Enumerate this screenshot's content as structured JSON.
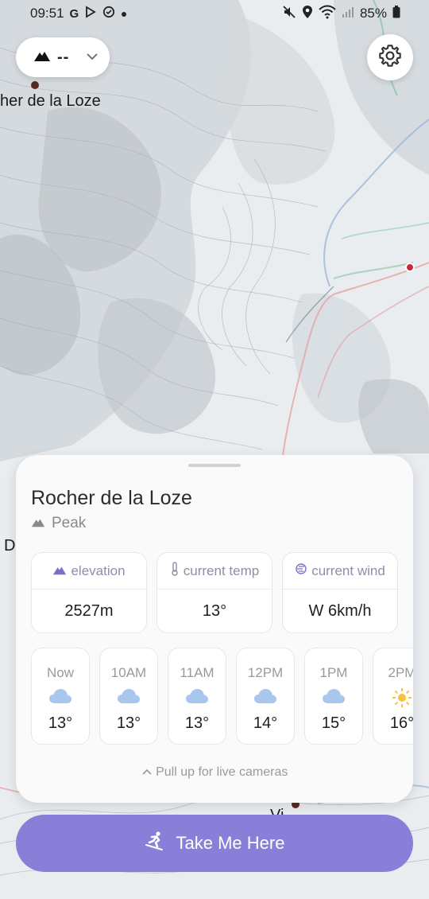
{
  "status_bar": {
    "time": "09:51",
    "left_icons": [
      "G",
      "play-store-icon",
      "shield-icon",
      "dot-icon"
    ],
    "battery": "85%"
  },
  "map": {
    "labels": [
      "her de la Loze",
      "D",
      "Vi"
    ]
  },
  "top_controls": {
    "elevation_value": "--"
  },
  "sheet": {
    "title": "Rocher de la Loze",
    "type": "Peak",
    "stats": [
      {
        "label": "elevation",
        "value": "2527m",
        "icon": "mountain-icon"
      },
      {
        "label": "current temp",
        "value": "13°",
        "icon": "thermometer-icon"
      },
      {
        "label": "current wind",
        "value": "W 6km/h",
        "icon": "wind-icon"
      }
    ],
    "hourly": [
      {
        "time": "Now",
        "temp": "13°",
        "icon": "cloud-icon"
      },
      {
        "time": "10AM",
        "temp": "13°",
        "icon": "cloud-icon"
      },
      {
        "time": "11AM",
        "temp": "13°",
        "icon": "cloud-icon"
      },
      {
        "time": "12PM",
        "temp": "14°",
        "icon": "cloud-icon"
      },
      {
        "time": "1PM",
        "temp": "15°",
        "icon": "cloud-icon"
      },
      {
        "time": "2PM",
        "temp": "16°",
        "icon": "sun-icon"
      }
    ],
    "pull_hint": "Pull up for live cameras"
  },
  "cta": {
    "label": "Take Me Here"
  },
  "colors": {
    "accent": "#8a7fd8",
    "pin_red": "#c8283a",
    "label_purple": "#8f8da8"
  }
}
